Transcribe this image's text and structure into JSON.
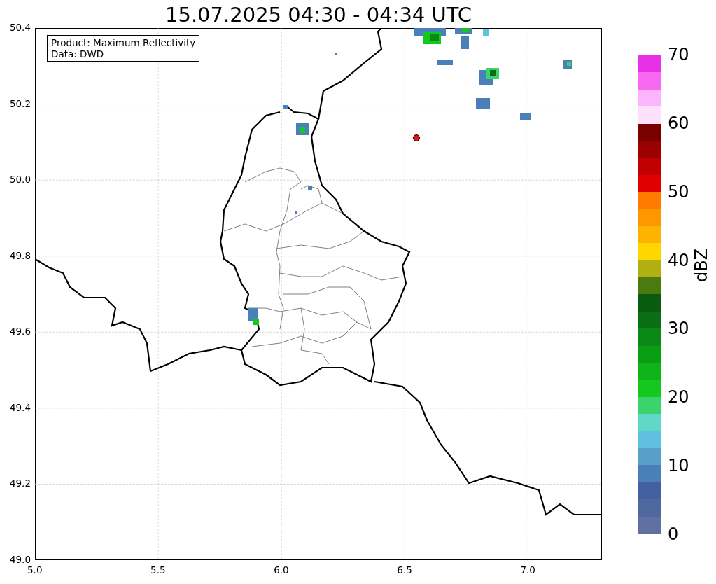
{
  "title": "15.07.2025 04:30 - 04:34 UTC",
  "legend": [
    "Product: Maximum Reflectivity",
    "Data: DWD"
  ],
  "y_ticks": [
    "50.4",
    "50.2",
    "50.0",
    "49.8",
    "49.6",
    "49.4",
    "49.2",
    "49.0"
  ],
  "x_ticks": [
    "5.0",
    "5.5",
    "6.0",
    "6.5",
    "7.0"
  ],
  "colorbar": {
    "label": "dBZ",
    "ticks": [
      "70",
      "60",
      "50",
      "40",
      "30",
      "20",
      "10",
      "0"
    ],
    "bands": [
      {
        "color": "#e830e8"
      },
      {
        "color": "#f868f0"
      },
      {
        "color": "#fcb4fc"
      },
      {
        "color": "#fde0fc"
      },
      {
        "color": "#7a0000"
      },
      {
        "color": "#9c0000"
      },
      {
        "color": "#c00000"
      },
      {
        "color": "#e00000"
      },
      {
        "color": "#ff7b00"
      },
      {
        "color": "#ff9800"
      },
      {
        "color": "#ffb300"
      },
      {
        "color": "#ffd700"
      },
      {
        "color": "#b0b010"
      },
      {
        "color": "#4a7a10"
      },
      {
        "color": "#0a5a10"
      },
      {
        "color": "#0a6e14"
      },
      {
        "color": "#0a8a14"
      },
      {
        "color": "#0a9e14"
      },
      {
        "color": "#10b41a"
      },
      {
        "color": "#14c81e"
      },
      {
        "color": "#3cd26e"
      },
      {
        "color": "#60d8c8"
      },
      {
        "color": "#60c0e0"
      },
      {
        "color": "#58a0c8"
      },
      {
        "color": "#4a80b8"
      },
      {
        "color": "#4460a0"
      },
      {
        "color": "#5068a0"
      },
      {
        "color": "#6070a0"
      }
    ]
  }
}
